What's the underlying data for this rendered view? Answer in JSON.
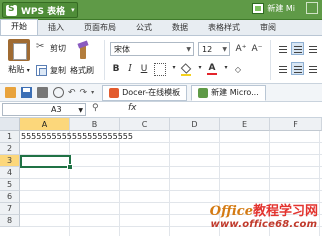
{
  "titlebar": {
    "app_label": "WPS 表格",
    "caret": "▾",
    "doc_label": "新建 Mi",
    "bg_color": "#5f9a47"
  },
  "tabs": [
    "开始",
    "插入",
    "页面布局",
    "公式",
    "数据",
    "表格样式",
    "审阅"
  ],
  "active_tab": "开始",
  "ribbon": {
    "paste_label": "粘贴",
    "cut_label": "剪切",
    "copy_label": "复制",
    "format_painter_label": "格式刷",
    "font_name": "宋体",
    "font_size": "12",
    "grow_font": "A⁺",
    "shrink_font": "A⁻",
    "bold": "B",
    "italic": "I",
    "underline": "U",
    "border_icon": "border-icon",
    "fill_icon": "fill-color-icon",
    "font_color_label": "A",
    "font_color": "#e3242b",
    "fill_color": "#f5d21f"
  },
  "quickbar": {
    "undo": "↶",
    "redo": "↷",
    "docer_tab": "Docer-在线模板",
    "doc_tab": "新建 Micro..."
  },
  "formula_bar": {
    "cell_ref": "A3",
    "fx": "fx",
    "content": ""
  },
  "sheet": {
    "columns": [
      "A",
      "B",
      "C",
      "D",
      "E",
      "F"
    ],
    "rows": [
      "1",
      "2",
      "3",
      "4",
      "5",
      "6",
      "7",
      "8"
    ],
    "selected_column": "A",
    "selected_row": "3",
    "cells": {
      "A1": "5555555555555555555555"
    },
    "active_cell_color": "#207245"
  },
  "watermark": {
    "line1_a": "Office",
    "line1_b": "教程学习网",
    "line2": "www.office68.com"
  }
}
